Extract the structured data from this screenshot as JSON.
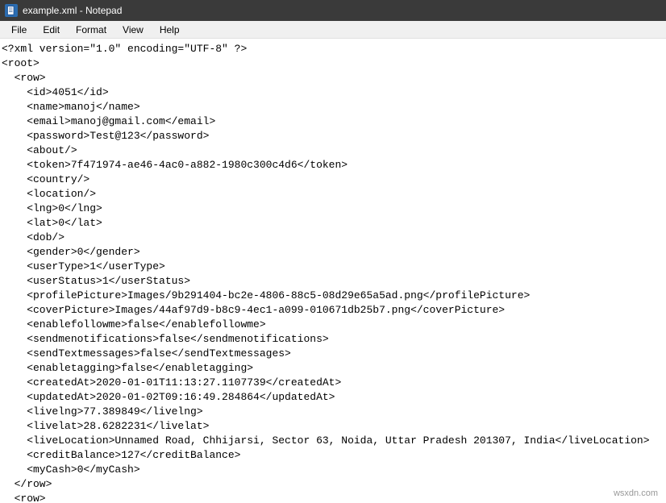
{
  "window": {
    "title": "example.xml - Notepad"
  },
  "menu": {
    "file": "File",
    "edit": "Edit",
    "format": "Format",
    "view": "View",
    "help": "Help"
  },
  "content": {
    "lines": [
      "<?xml version=\"1.0\" encoding=\"UTF-8\" ?>",
      "<root>",
      "  <row>",
      "    <id>4051</id>",
      "    <name>manoj</name>",
      "    <email>manoj@gmail.com</email>",
      "    <password>Test@123</password>",
      "    <about/>",
      "    <token>7f471974-ae46-4ac0-a882-1980c300c4d6</token>",
      "    <country/>",
      "    <location/>",
      "    <lng>0</lng>",
      "    <lat>0</lat>",
      "    <dob/>",
      "    <gender>0</gender>",
      "    <userType>1</userType>",
      "    <userStatus>1</userStatus>",
      "    <profilePicture>Images/9b291404-bc2e-4806-88c5-08d29e65a5ad.png</profilePicture>",
      "    <coverPicture>Images/44af97d9-b8c9-4ec1-a099-010671db25b7.png</coverPicture>",
      "    <enablefollowme>false</enablefollowme>",
      "    <sendmenotifications>false</sendmenotifications>",
      "    <sendTextmessages>false</sendTextmessages>",
      "    <enabletagging>false</enabletagging>",
      "    <createdAt>2020-01-01T11:13:27.1107739</createdAt>",
      "    <updatedAt>2020-01-02T09:16:49.284864</updatedAt>",
      "    <livelng>77.389849</livelng>",
      "    <livelat>28.6282231</livelat>",
      "    <liveLocation>Unnamed Road, Chhijarsi, Sector 63, Noida, Uttar Pradesh 201307, India</liveLocation>",
      "    <creditBalance>127</creditBalance>",
      "    <myCash>0</myCash>",
      "  </row>",
      "  <row>"
    ]
  },
  "watermark": "wsxdn.com"
}
